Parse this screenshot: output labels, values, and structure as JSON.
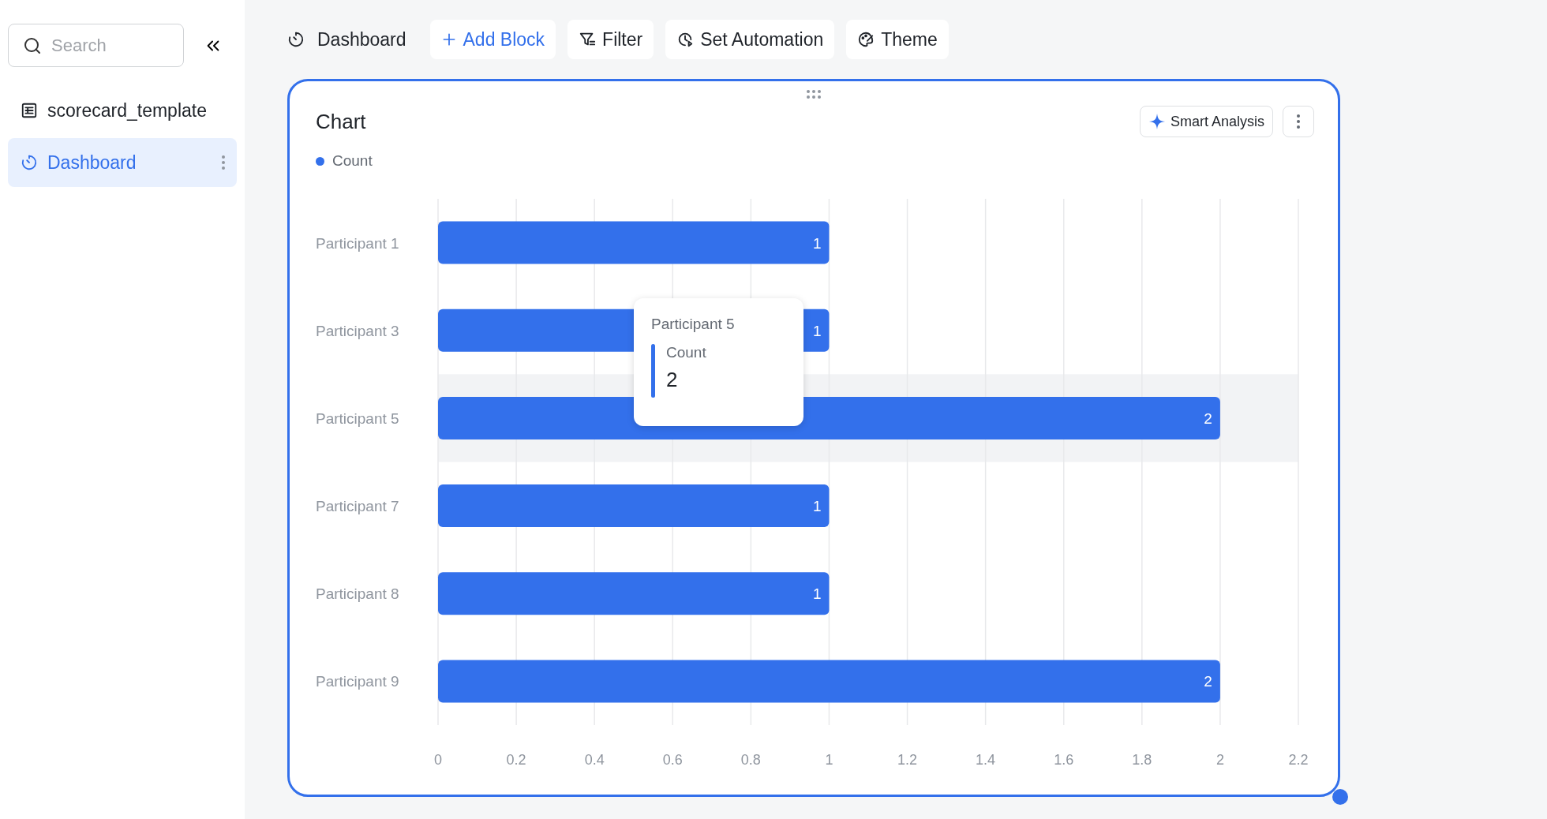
{
  "sidebar": {
    "search": {
      "placeholder": "Search"
    },
    "items": [
      {
        "kind": "table",
        "label": "scorecard_template",
        "selected": false
      },
      {
        "kind": "dashboard",
        "label": "Dashboard",
        "selected": true
      }
    ]
  },
  "toolbar": {
    "title": "Dashboard",
    "buttons": [
      {
        "kind": "add",
        "label": "Add Block",
        "primary": true
      },
      {
        "kind": "filter",
        "label": "Filter",
        "primary": false
      },
      {
        "kind": "automation",
        "label": "Set Automation",
        "primary": false
      },
      {
        "kind": "theme",
        "label": "Theme",
        "primary": false
      }
    ]
  },
  "block": {
    "title": "Chart",
    "smart_button": "Smart Analysis",
    "selected": true,
    "chart_data": {
      "type": "bar",
      "orientation": "horizontal",
      "categories": [
        "Participant 1",
        "Participant 3",
        "Participant 5",
        "Participant 7",
        "Participant 8",
        "Participant 9"
      ],
      "series": [
        {
          "name": "Count",
          "color": "#3370eb",
          "values": [
            1,
            1,
            2,
            1,
            1,
            2
          ]
        }
      ],
      "xlim": [
        0,
        2.2
      ],
      "xticks": [
        0,
        {
          "value": 0.2,
          "label": "0.2"
        },
        {
          "value": 0.4,
          "label": "0.4"
        },
        {
          "value": 0.6,
          "label": "0.6"
        },
        {
          "value": 0.8,
          "label": "0.8"
        },
        1,
        {
          "value": 1.2,
          "label": "1.2"
        },
        {
          "value": 1.4,
          "label": "1.4"
        },
        {
          "value": 1.6,
          "label": "1.6"
        },
        {
          "value": 1.8,
          "label": "1.8"
        },
        2,
        {
          "value": 2.2,
          "label": "2.2"
        }
      ],
      "grid": true,
      "bands": [
        {
          "axis": "y",
          "from": "Participant 5",
          "to": "Participant 5",
          "color": "#f2f3f5"
        }
      ],
      "data_labels": true
    },
    "tooltip": {
      "title": "Participant 5",
      "series": "Count",
      "value": "2",
      "color": "#3370eb"
    }
  }
}
